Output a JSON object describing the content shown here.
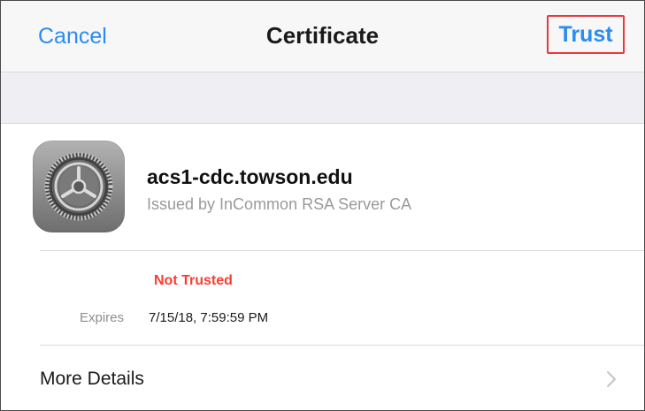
{
  "nav": {
    "cancel_label": "Cancel",
    "title": "Certificate",
    "trust_label": "Trust"
  },
  "certificate": {
    "icon": "settings-gear-icon",
    "name": "acs1-cdc.towson.edu",
    "issuer": "Issued by InCommon RSA Server CA",
    "status": "Not Trusted",
    "expires_label": "Expires",
    "expires_value": "7/15/18, 7:59:59 PM"
  },
  "more_details": {
    "label": "More Details",
    "icon": "chevron-right-icon"
  },
  "colors": {
    "accent_blue": "#2a8cf2",
    "not_trusted_red": "#ff3b30",
    "highlight_box": "#e8383d"
  }
}
